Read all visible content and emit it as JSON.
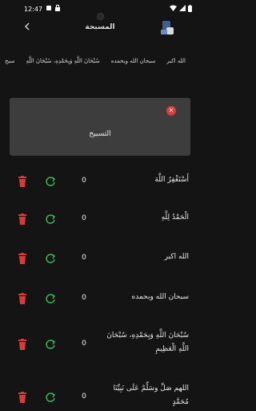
{
  "status": {
    "time": "12:47"
  },
  "app_bar": {
    "title": "المسبحة"
  },
  "chips": [
    "الله اكبر",
    "سبحان الله وبحمده",
    "سُبْحَانَ اللَّهِ وَبِحَمْدِهِ، سُبْحَانَ اللَّهِ",
    "سبح"
  ],
  "panel": {
    "text": "التسبيح"
  },
  "rows": [
    {
      "text": "أَسْتَغْفِرُ اللَّهَ",
      "count": "0"
    },
    {
      "text": "الْحَمْدُ لِلَّهِ",
      "count": "0"
    },
    {
      "text": "الله اكبر",
      "count": "0"
    },
    {
      "text": "سبحان الله وبحمده",
      "count": "0"
    },
    {
      "text": "سُبْحَانَ اللَّهِ وَبِحَمْدِهِ، سُبْحَانَ اللَّهِ الْعَظِيمِ",
      "count": "0"
    },
    {
      "text": "اللهم صَلِّ وسَلِّمْ عَلَى نَبِيِّنَا مُحَمَّدٍ",
      "count": "0"
    }
  ],
  "colors": {
    "delete": "#d83a3a",
    "reset": "#3fbf5a",
    "panel": "#3d3d3d",
    "background": "#141414"
  }
}
